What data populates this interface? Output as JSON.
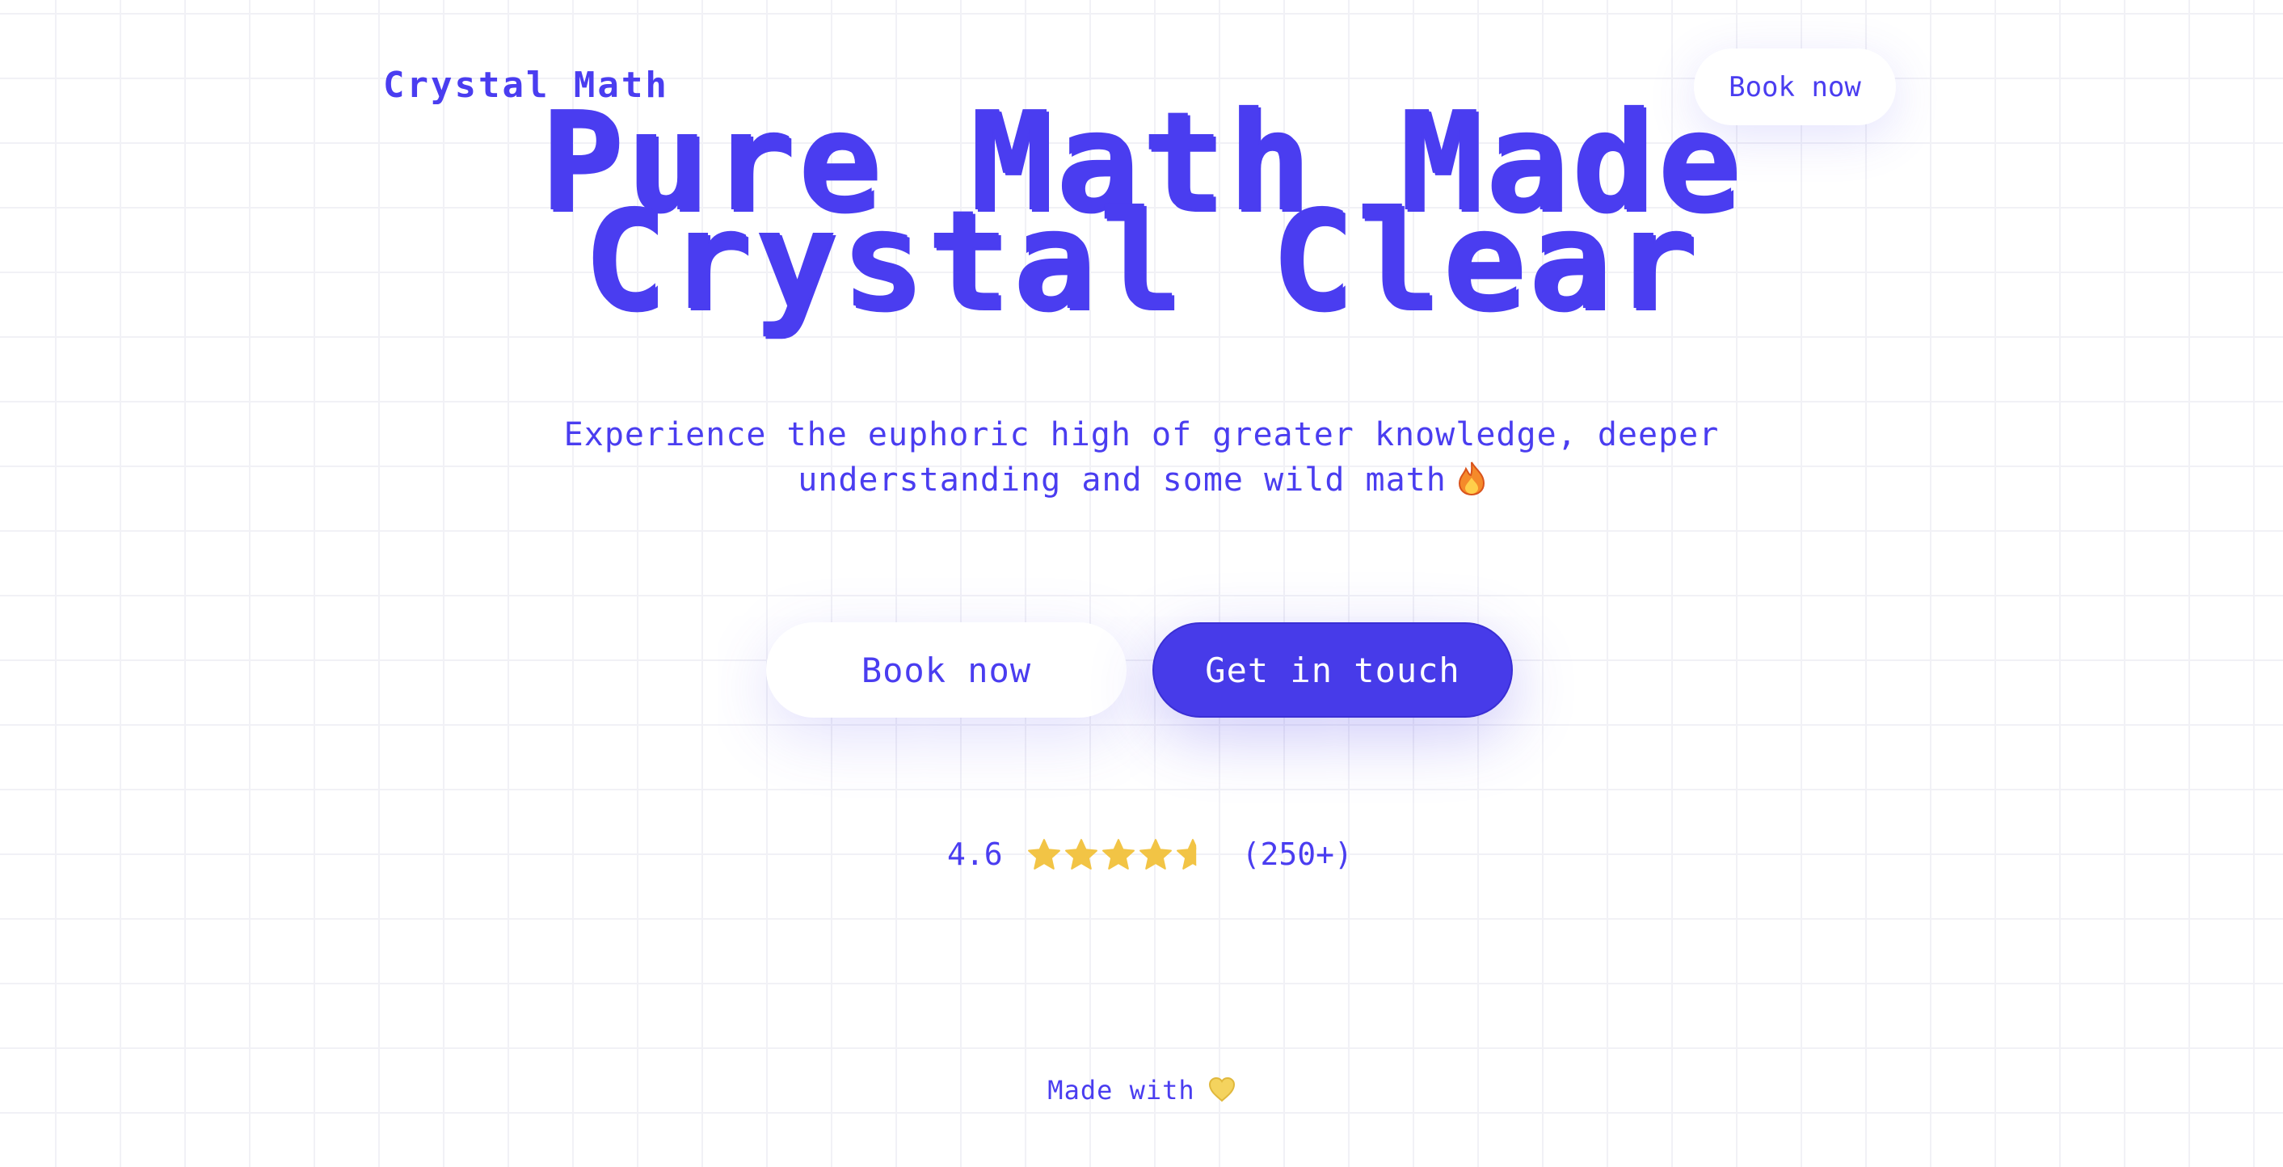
{
  "brand": {
    "name": "Crystal Math"
  },
  "nav": {
    "book_label": "Book now"
  },
  "hero": {
    "title_line1": "Pure Math Made",
    "title_line2": "Crystal Clear",
    "subtitle_line1": "Experience the euphoric high of greater knowledge, deeper",
    "subtitle_line2": "understanding and some wild math",
    "subtitle_icon": "fire-icon"
  },
  "cta": {
    "book_label": "Book now",
    "contact_label": "Get in touch"
  },
  "rating": {
    "score": "4.6",
    "stars": 4.6,
    "max_stars": 5,
    "count": "(250+)",
    "star_icon": "star-icon"
  },
  "footer": {
    "credit": "Made with",
    "credit_icon": "heart-icon"
  },
  "colors": {
    "accent": "#4a3df0",
    "button_primary": "#473be9",
    "star": "#f2c445",
    "heart": "#f4d35e",
    "background": "#ffffff",
    "grid": "#f1f1f6"
  }
}
